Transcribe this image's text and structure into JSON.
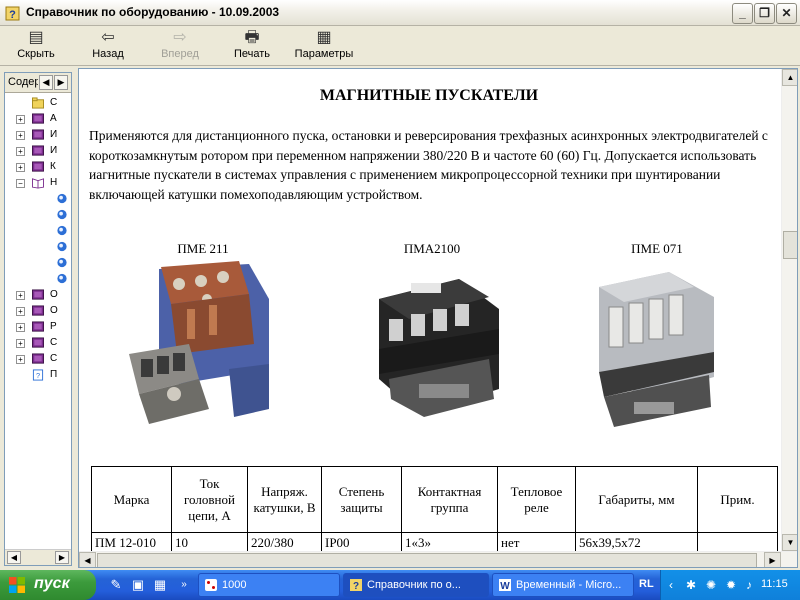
{
  "window": {
    "title": "Справочник по оборудованию - 10.09.2003",
    "min_glyph": "_",
    "max_glyph": "❐",
    "close_glyph": "✕"
  },
  "toolbar": {
    "hide": "Скрыть",
    "back": "Назад",
    "forward": "Вперед",
    "print": "Печать",
    "options": "Параметры"
  },
  "nav": {
    "tab_label": "Содер",
    "items": [
      {
        "text": "С",
        "expand": "",
        "icon": "folder"
      },
      {
        "text": "А",
        "expand": "+",
        "icon": "book"
      },
      {
        "text": "И",
        "expand": "+",
        "icon": "book"
      },
      {
        "text": "И",
        "expand": "+",
        "icon": "book"
      },
      {
        "text": "К",
        "expand": "+",
        "icon": "book"
      },
      {
        "text": "Н",
        "expand": "−",
        "icon": "open-book"
      },
      {
        "text": "",
        "expand": "",
        "icon": "page"
      },
      {
        "text": "",
        "expand": "",
        "icon": "page"
      },
      {
        "text": "",
        "expand": "",
        "icon": "page"
      },
      {
        "text": "",
        "expand": "",
        "icon": "page"
      },
      {
        "text": "",
        "expand": "",
        "icon": "page"
      },
      {
        "text": "",
        "expand": "",
        "icon": "page"
      },
      {
        "text": "О",
        "expand": "+",
        "icon": "book"
      },
      {
        "text": "О",
        "expand": "+",
        "icon": "book"
      },
      {
        "text": "Р",
        "expand": "+",
        "icon": "book"
      },
      {
        "text": "С",
        "expand": "+",
        "icon": "book"
      },
      {
        "text": "С",
        "expand": "+",
        "icon": "book"
      },
      {
        "text": "П",
        "expand": "",
        "icon": "help-page"
      }
    ]
  },
  "content": {
    "heading": "МАГНИТНЫЕ ПУСКАТЕЛИ",
    "paragraph": "Применяются для дистанционного пуска, остановки и реверсирования трехфазных асинхронных электродвигателей с короткозамкнутым ротором при переменном напряжении 380/220 В и частоте 60 (60) Гц. Допускается использовать иагнитные пускатели в системах управления с применением микропроцессорной техники при шунтировании включающей катушки помехоподавляющим устройством.",
    "products": [
      {
        "label": "ПМЕ 211"
      },
      {
        "label": "ПМА2100"
      },
      {
        "label": "ПМЕ 071"
      }
    ],
    "table": {
      "headers": [
        "Марка",
        "Ток головной цепи, А",
        "Напряж. катушки, В",
        "Степень защиты",
        "Контактная группа",
        "Тепловое реле",
        "Габариты, мм",
        "Прим."
      ],
      "rows": [
        [
          "ПМ 12-010",
          "10",
          "220/380",
          "IP00",
          "1«3»",
          "нет",
          "56х39,5х72",
          ""
        ]
      ]
    }
  },
  "taskbar": {
    "start": "пуск",
    "tasks": [
      {
        "label": "1000"
      },
      {
        "label": "Справочник по о..."
      },
      {
        "label": "Временный - Micro..."
      }
    ],
    "language": "RL",
    "clock": "11:15"
  },
  "colors": {
    "taskbar": "#245edb",
    "start": "#3c9b3c",
    "book": "#7b2d8e"
  }
}
